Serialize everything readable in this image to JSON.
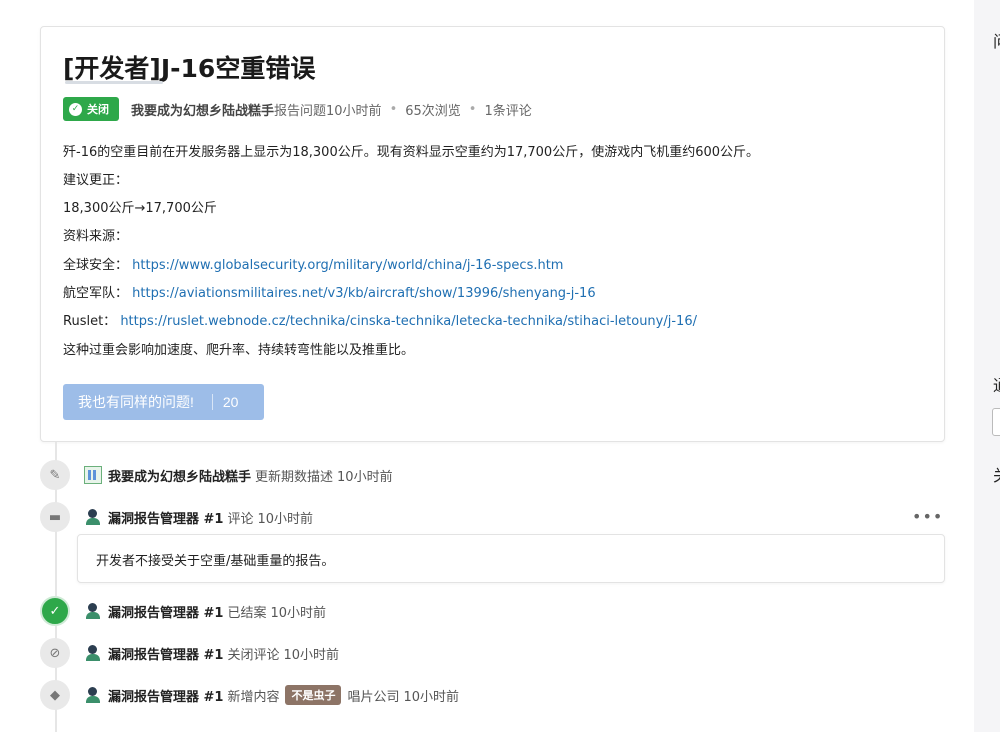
{
  "topic": {
    "title": "[开发者]J-16空重错误",
    "status_badge": "关闭",
    "author": "我要成为幻想乡陆战糕手",
    "reported_meta": "报告问题10小时前",
    "views": "65次浏览",
    "comments": "1条评论",
    "body": [
      "歼-16的空重目前在开发服务器上显示为18,300公斤。现有资料显示空重约为17,700公斤，使游戏内飞机重约600公斤。",
      "建议更正：",
      "18,300公斤→17,700公斤",
      "资料来源："
    ],
    "sources": [
      {
        "label": "全球安全：",
        "url": "https://www.globalsecurity.org/military/world/china/j-16-specs.htm"
      },
      {
        "label": "航空军队：",
        "url": "https://aviationsmilitaires.net/v3/kb/aircraft/show/13996/shenyang-j-16"
      },
      {
        "label": "Ruslet：",
        "url": "https://ruslet.webnode.cz/technika/cinska-technika/letecka-technika/stihaci-letouny/j-16/"
      }
    ],
    "closing": "这种过重会影响加速度、爬升率、持续转弯性能以及推重比。",
    "me_too_label": "我也有同样的问题!",
    "me_too_count": "20"
  },
  "timeline": [
    {
      "icon": "pencil-icon",
      "user": "我要成为幻想乡陆战糕手",
      "action": "更新期数描述",
      "time": "10小时前"
    },
    {
      "icon": "comment-icon",
      "user": "漏洞报告管理器 #1",
      "action": "评论",
      "time": "10小时前",
      "comment": "开发者不接受关于空重/基础重量的报告。"
    },
    {
      "icon": "check-icon",
      "user": "漏洞报告管理器 #1",
      "action": "已结案",
      "time": "10小时前"
    },
    {
      "icon": "comment-off-icon",
      "user": "漏洞报告管理器 #1",
      "action": "关闭评论",
      "time": "10小时前"
    },
    {
      "icon": "tag-icon",
      "user": "漏洞报告管理器 #1",
      "action": "新增内容",
      "tag": "不是虫子",
      "extra": "唱片公司",
      "time": "10小时前"
    }
  ],
  "more_label": "•••",
  "sidebar": {
    "text1": "问",
    "text2": "通",
    "text3": "关"
  },
  "colors": {
    "badge_green": "#2ea84a",
    "tag_brown": "#8d7466",
    "link_blue": "#1f6fb2",
    "button_blue": "#9dbde8"
  }
}
